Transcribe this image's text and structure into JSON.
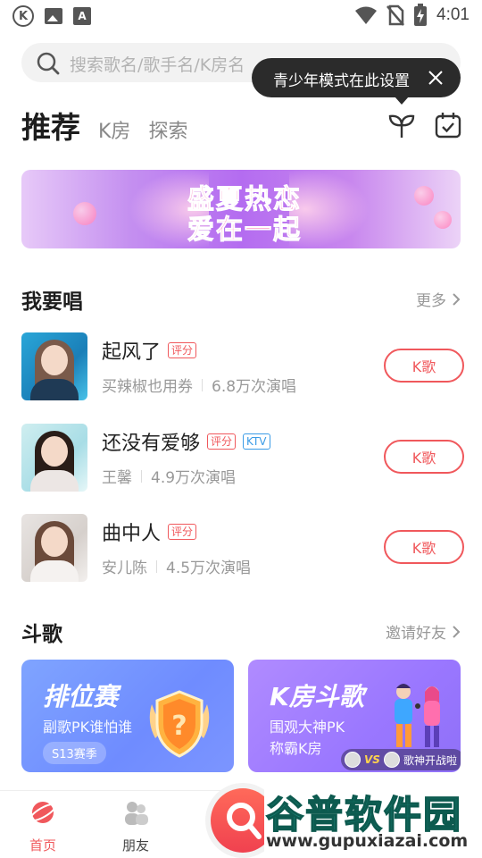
{
  "status_bar": {
    "time": "4:01",
    "left_icons": [
      "k-app-icon",
      "image-icon",
      "a-app-icon"
    ],
    "right_icons": [
      "wifi-icon",
      "no-sim-icon",
      "battery-charging-icon"
    ],
    "k_glyph": "K",
    "a_glyph": "A"
  },
  "search": {
    "placeholder": "搜索歌名/歌手名/K房名"
  },
  "tooltip": {
    "text": "青少年模式在此设置"
  },
  "tabs": [
    {
      "label": "推荐",
      "active": true
    },
    {
      "label": "K房",
      "active": false
    },
    {
      "label": "探索",
      "active": false
    }
  ],
  "banner": {
    "line1": "盛夏热恋",
    "line2": "爱在一起"
  },
  "sing_section": {
    "title": "我要唱",
    "more": "更多",
    "songs": [
      {
        "title": "起风了",
        "tags": [
          "评分"
        ],
        "artist": "买辣椒也用券",
        "plays": "6.8万次演唱",
        "button": "K歌"
      },
      {
        "title": "还没有爱够",
        "tags": [
          "评分",
          "KTV"
        ],
        "artist": "王馨",
        "plays": "4.9万次演唱",
        "button": "K歌"
      },
      {
        "title": "曲中人",
        "tags": [
          "评分"
        ],
        "artist": "安儿陈",
        "plays": "4.5万次演唱",
        "button": "K歌"
      }
    ]
  },
  "battle_section": {
    "title": "斗歌",
    "more": "邀请好友",
    "cards": [
      {
        "title": "排位赛",
        "subtitle": "副歌PK谁怕谁",
        "season": "S13赛季"
      },
      {
        "title": "K房斗歌",
        "subtitle_line1": "围观大神PK",
        "subtitle_line2": "称霸K房",
        "footer": "歌神开战啦",
        "vs": "VS"
      }
    ]
  },
  "bottom_nav": {
    "items": [
      {
        "label": "首页",
        "active": true
      },
      {
        "label": "朋友",
        "active": false
      }
    ]
  },
  "watermark": {
    "cn": "谷普软件园",
    "url": "www.gupuxiazai.com"
  },
  "colors": {
    "accent": "#f0585c",
    "ktv_tag": "#3a9be6",
    "tooltip_bg": "#2b2b2b"
  }
}
